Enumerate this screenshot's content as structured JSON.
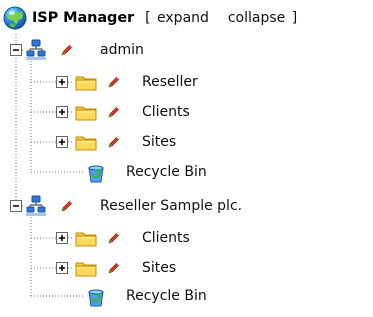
{
  "tree": {
    "root_label": "ISP Manager",
    "expand_label": "expand",
    "collapse_label": "collapse",
    "open_bracket": "[",
    "close_bracket": "]",
    "nodes": [
      {
        "label": "admin",
        "children": [
          {
            "label": "Reseller"
          },
          {
            "label": "Clients"
          },
          {
            "label": "Sites"
          },
          {
            "label": "Recycle Bin"
          }
        ]
      },
      {
        "label": "Reseller Sample plc.",
        "children": [
          {
            "label": "Clients"
          },
          {
            "label": "Sites"
          },
          {
            "label": "Recycle Bin"
          }
        ]
      }
    ]
  },
  "colors": {
    "folder": "#f4c63a",
    "folder_dark": "#d89e12",
    "network_blue": "#2f78d8",
    "pencil_red": "#d83a1f",
    "pencil_green": "#46a22f",
    "recycle_blue": "#4f9fe1",
    "tree_line": "#777777"
  },
  "icons": {
    "root": "globe-icon",
    "expanded": "minus-box-icon",
    "collapsed": "plus-box-icon",
    "account": "network-icon",
    "folder": "folder-icon",
    "edit": "pencil-icon",
    "recycle": "recycle-bin-icon"
  }
}
